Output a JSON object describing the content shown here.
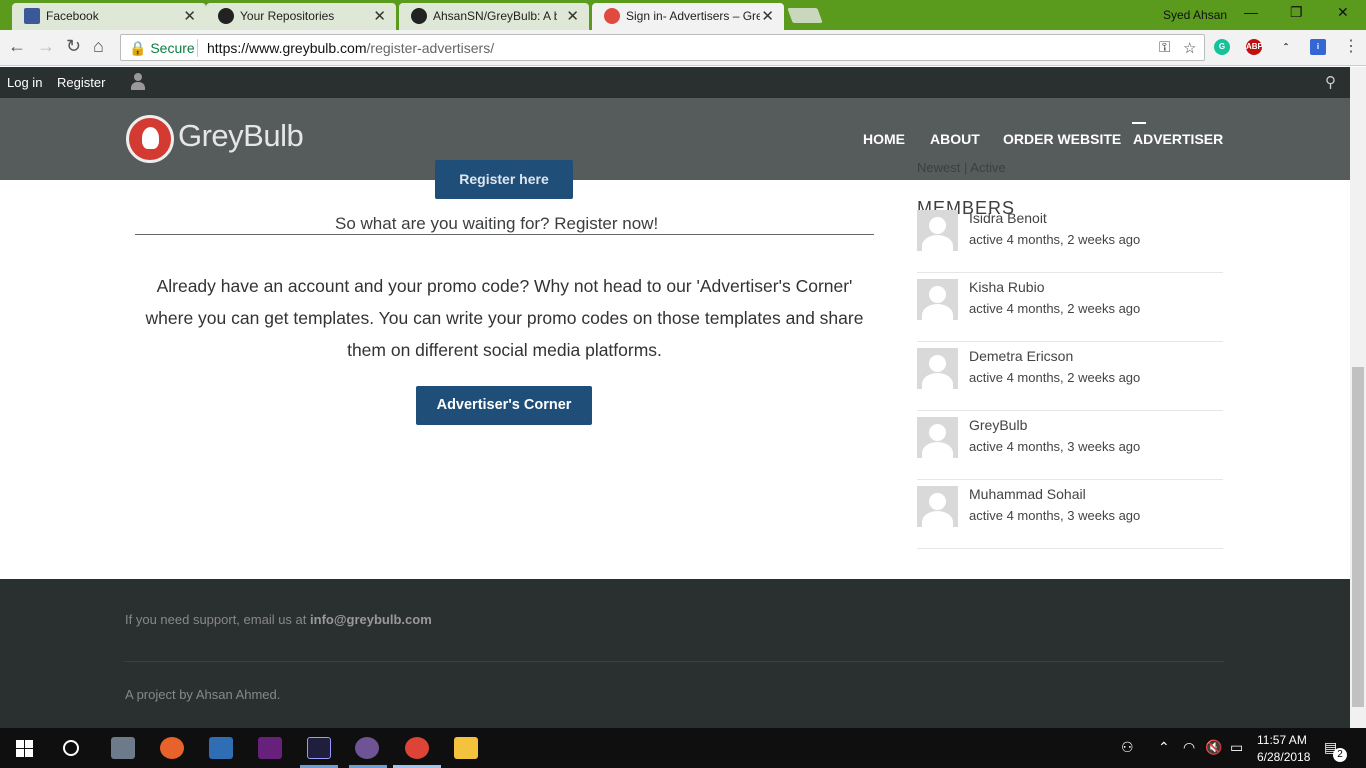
{
  "browser": {
    "tabs": [
      {
        "title": "Facebook",
        "active": false
      },
      {
        "title": "Your Repositories",
        "active": false
      },
      {
        "title": "AhsanSN/GreyBulb: A bu",
        "active": false
      },
      {
        "title": "Sign in- Advertisers – Gre",
        "active": true
      }
    ],
    "user": "Syed Ahsan",
    "secure_label": "Secure",
    "url_host": "https://www.greybulb.com",
    "url_path": "/register-advertisers/",
    "ext_abp": "ABP"
  },
  "site": {
    "topbar": {
      "login": "Log in",
      "register": "Register"
    },
    "logo_text": "GreyBulb",
    "nav": [
      "HOME",
      "ABOUT",
      "ORDER WEBSITE",
      "ADVERTISER"
    ],
    "cta_text": "So what are you waiting for? Register now!",
    "register_button": "Register here",
    "intro_text": "Already have an account and your promo code? Why not head to our 'Advertiser's Corner' where you can get templates. You can write your promo codes on those templates and share them on different social media platforms.",
    "corner_button": "Advertiser's Corner"
  },
  "members": {
    "title": "MEMBERS",
    "filter_newest": "Newest",
    "filter_sep": "|",
    "filter_active": "Active",
    "list": [
      {
        "name": "Isidra Benoit",
        "active": "active 4 months, 2 weeks ago"
      },
      {
        "name": "Kisha Rubio",
        "active": "active 4 months, 2 weeks ago"
      },
      {
        "name": "Demetra Ericson",
        "active": "active 4 months, 2 weeks ago"
      },
      {
        "name": "GreyBulb",
        "active": "active 4 months, 3 weeks ago"
      },
      {
        "name": "Muhammad Sohail",
        "active": "active 4 months, 3 weeks ago"
      }
    ]
  },
  "footer": {
    "support_prefix": "If you need support, email us at",
    "support_email": "info@greybulb.com",
    "credit": "A project by Ahsan Ahmed."
  },
  "taskbar": {
    "time": "11:57 AM",
    "date": "6/28/2018",
    "notifications": "2"
  }
}
